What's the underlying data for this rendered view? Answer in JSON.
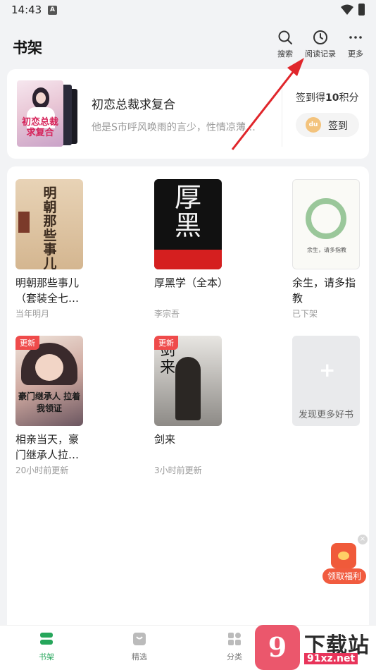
{
  "status": {
    "time": "14:43",
    "sim_label": "A"
  },
  "header": {
    "title": "书架",
    "actions": [
      {
        "label": "搜索",
        "icon": "search-icon"
      },
      {
        "label": "阅读记录",
        "icon": "clock-icon"
      },
      {
        "label": "更多",
        "icon": "more-icon"
      }
    ]
  },
  "recommend": {
    "cover_text": "初恋总裁求复合",
    "title": "初恋总裁求复合",
    "desc": "他是S市呼风唤雨的言少，性情凉薄…",
    "signin_text_prefix": "签到得",
    "signin_points": "10",
    "signin_text_suffix": "积分",
    "coin_label": "du",
    "signin_button": "签到"
  },
  "shelf": {
    "books": [
      {
        "title": "明朝那些事儿（套装全七…",
        "sub": "当年明月",
        "badge": "",
        "cover_text": "明朝那些事儿"
      },
      {
        "title": "厚黑学（全本）",
        "sub": "李宗吾",
        "badge": "",
        "cover_text": "厚黑"
      },
      {
        "title": "余生，请多指教",
        "sub": "已下架",
        "badge": "",
        "cover_text": "余生，请多指教"
      },
      {
        "title": "相亲当天，豪门继承人拉…",
        "sub": "20小时前更新",
        "badge": "更新",
        "cover_text": "豪门继承人 拉着我领证"
      },
      {
        "title": "剑来",
        "sub": "3小时前更新",
        "badge": "更新",
        "cover_text": "剑来"
      }
    ],
    "discover_label": "发现更多好书"
  },
  "float_ad": {
    "label": "领取福利",
    "close": "×"
  },
  "bottom_nav": [
    {
      "label": "书架",
      "active": true
    },
    {
      "label": "精选",
      "active": false
    },
    {
      "label": "分类",
      "active": false
    }
  ],
  "watermark": {
    "logo": "9",
    "title": "下载站",
    "url": "91xz.net"
  },
  "colors": {
    "accent": "#26a65b",
    "badge": "#ef4b4b",
    "annotation_arrow": "#e0262b"
  }
}
